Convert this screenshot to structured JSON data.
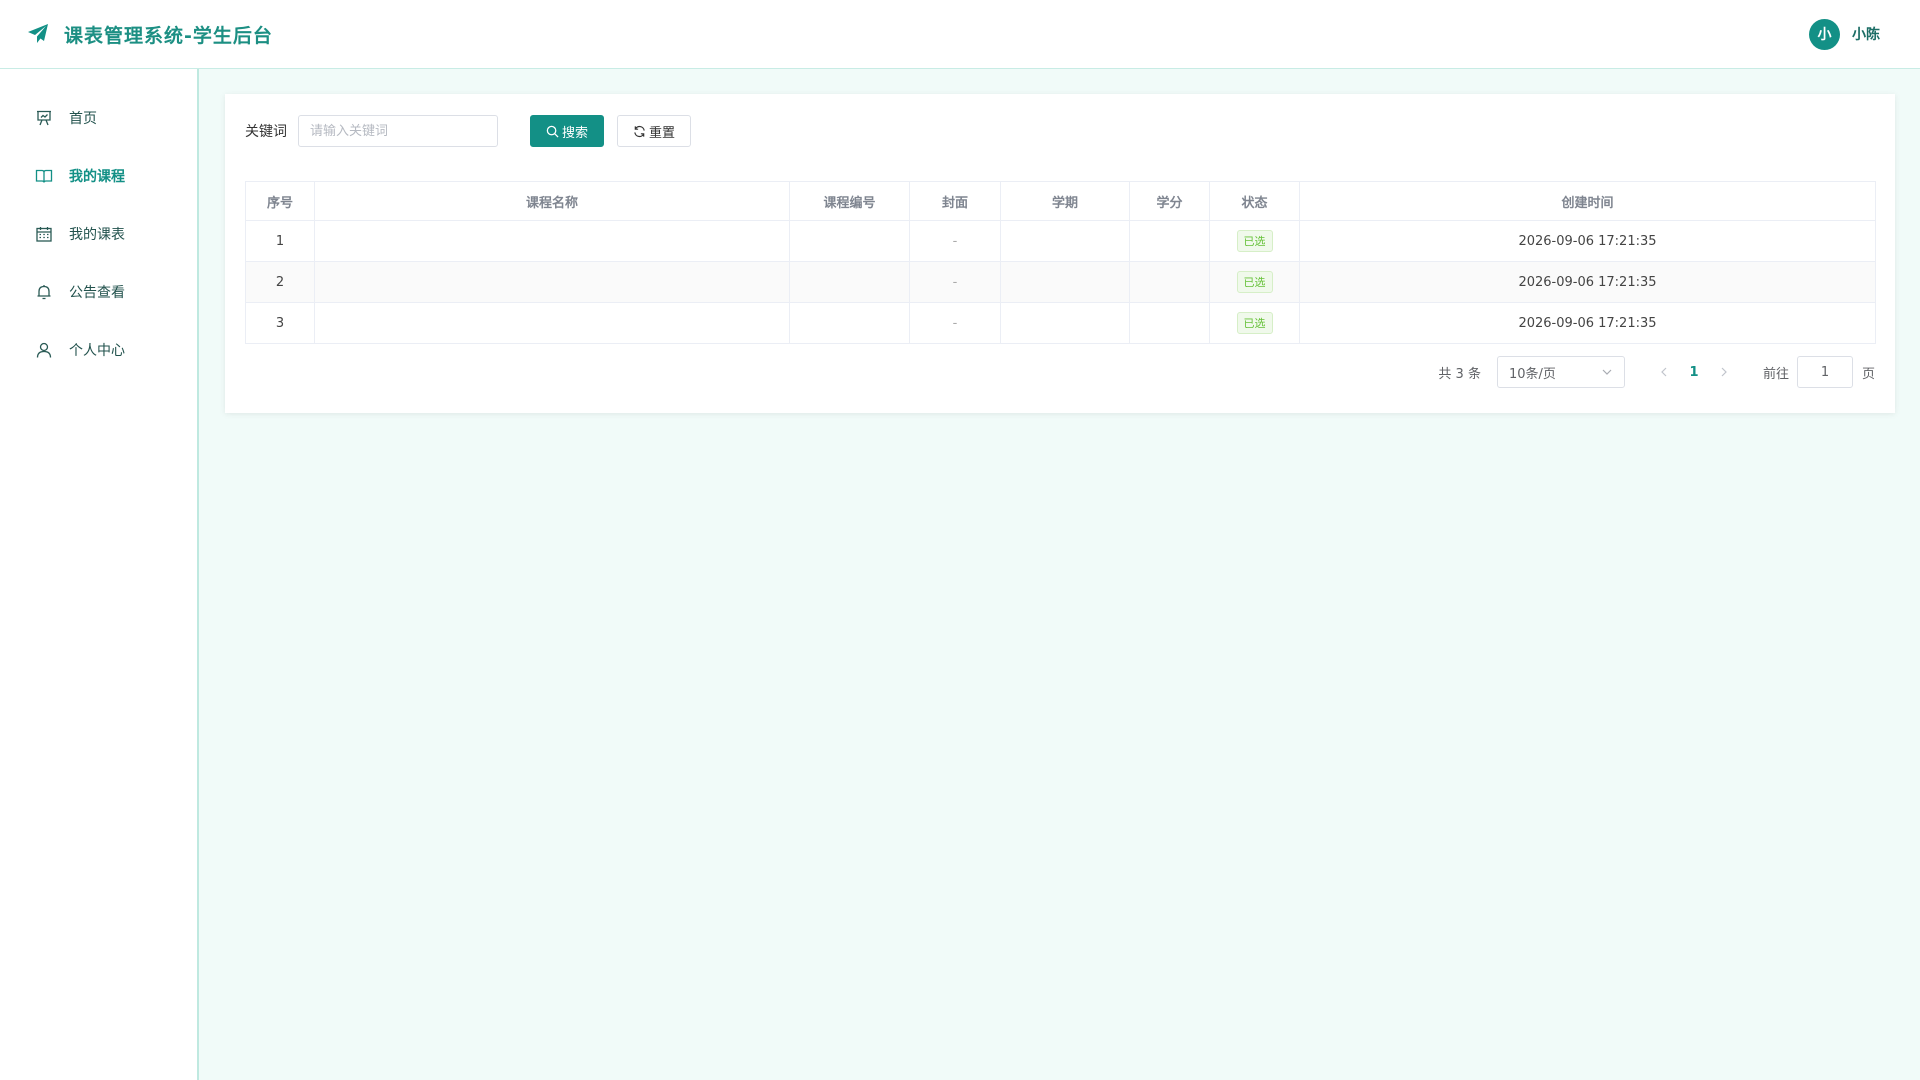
{
  "app": {
    "title": "课表管理系统-学生后台",
    "brand_color": "#139086",
    "brand_icon": "paper-plane-icon"
  },
  "user": {
    "avatar_text": "小",
    "name": "小陈"
  },
  "sidebar": {
    "items": [
      {
        "label": "首页",
        "icon": "presentation-chart-icon"
      },
      {
        "label": "我的课程",
        "icon": "open-book-icon",
        "active": true
      },
      {
        "label": "我的课表",
        "icon": "calendar-icon"
      },
      {
        "label": "公告查看",
        "icon": "bell-icon"
      },
      {
        "label": "个人中心",
        "icon": "user-icon"
      }
    ]
  },
  "search": {
    "label": "关键词",
    "placeholder": "请输入关键词",
    "value": "",
    "search_label": "搜索",
    "reset_label": "重置"
  },
  "table": {
    "columns": [
      "序号",
      "课程名称",
      "课程编号",
      "封面",
      "学期",
      "学分",
      "状态",
      "创建时间"
    ],
    "rows": [
      {
        "index": "1",
        "name": "",
        "code": "",
        "cover": "-",
        "term": "",
        "credit": "",
        "status": "已选",
        "created": "2026-09-06 17:21:35"
      },
      {
        "index": "2",
        "name": "",
        "code": "",
        "cover": "-",
        "term": "",
        "credit": "",
        "status": "已选",
        "created": "2026-09-06 17:21:35"
      },
      {
        "index": "3",
        "name": "",
        "code": "",
        "cover": "-",
        "term": "",
        "credit": "",
        "status": "已选",
        "created": "2026-09-06 17:21:35"
      }
    ]
  },
  "pagination": {
    "total_text": "共 3 条",
    "page_size": "10条/页",
    "current_page": "1",
    "goto_label": "前往",
    "goto_value": "1",
    "page_suffix": "页"
  }
}
